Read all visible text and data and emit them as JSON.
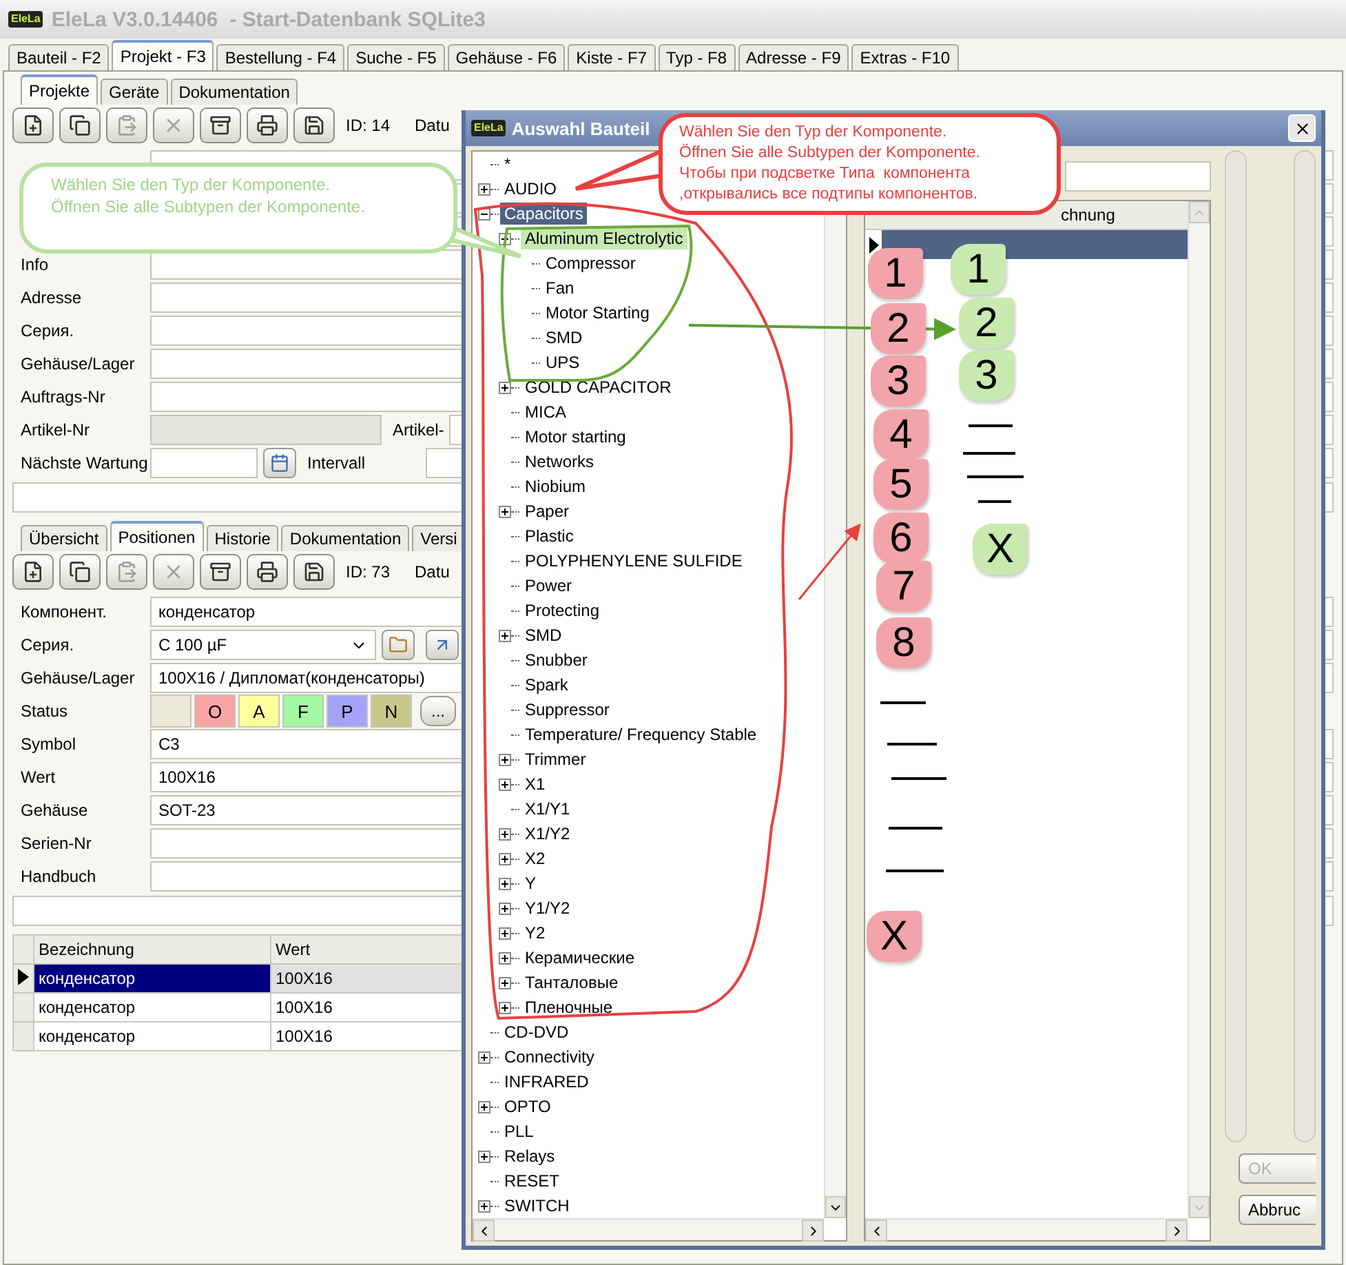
{
  "window": {
    "logo": "EleLa",
    "title": "EleLa V3.0.14406  - Start-Datenbank SQLite3"
  },
  "main_tabs": [
    {
      "label": "Bauteil - F2",
      "selected": false
    },
    {
      "label": "Projekt - F3",
      "selected": true
    },
    {
      "label": "Bestellung - F4",
      "selected": false
    },
    {
      "label": "Suche - F5",
      "selected": false
    },
    {
      "label": "Gehäuse - F6",
      "selected": false
    },
    {
      "label": "Kiste - F7",
      "selected": false
    },
    {
      "label": "Typ - F8",
      "selected": false
    },
    {
      "label": "Adresse - F9",
      "selected": false
    },
    {
      "label": "Extras - F10",
      "selected": false
    }
  ],
  "project_tabs": [
    {
      "label": "Projekte",
      "selected": true
    },
    {
      "label": "Geräte",
      "selected": false
    },
    {
      "label": "Dokumentation",
      "selected": false
    }
  ],
  "project_toolbar": {
    "buttons": [
      {
        "kind": "new",
        "disabled": false
      },
      {
        "kind": "copy",
        "disabled": false
      },
      {
        "kind": "paste",
        "disabled": true
      },
      {
        "kind": "delete",
        "disabled": true
      },
      {
        "kind": "archive",
        "disabled": false
      },
      {
        "kind": "print",
        "disabled": false
      },
      {
        "kind": "save",
        "disabled": false
      }
    ],
    "id": "ID: 14",
    "date_label": "Datu"
  },
  "project_form": {
    "fields": [
      {
        "label": "Info"
      },
      {
        "label": "Adresse"
      },
      {
        "label": "Серия."
      },
      {
        "label": "Gehäuse/Lager"
      },
      {
        "label": "Auftrags-Nr"
      }
    ],
    "article": {
      "label": "Artikel-Nr",
      "side_label": "Artikel-"
    },
    "maintenance": {
      "label": "Nächste Wartung",
      "interval_label": "Intervall"
    }
  },
  "position_tabs": [
    {
      "label": "Übersicht",
      "selected": false
    },
    {
      "label": "Positionen",
      "selected": true
    },
    {
      "label": "Historie",
      "selected": false
    },
    {
      "label": "Dokumentation",
      "selected": false
    },
    {
      "label": "Versi",
      "selected": false
    }
  ],
  "position_toolbar": {
    "buttons": [
      {
        "kind": "new",
        "disabled": false
      },
      {
        "kind": "copy",
        "disabled": false
      },
      {
        "kind": "paste",
        "disabled": true
      },
      {
        "kind": "delete",
        "disabled": true
      },
      {
        "kind": "archive",
        "disabled": false
      },
      {
        "kind": "print",
        "disabled": false
      },
      {
        "kind": "save",
        "disabled": false
      }
    ],
    "id": "ID: 73",
    "date_label": "Datu"
  },
  "position_form": {
    "component": {
      "label": "Компонент.",
      "value": "конденсатор"
    },
    "series": {
      "label": "Серия.",
      "value": "C 100 µF"
    },
    "housing_storage": {
      "label": "Gehäuse/Lager",
      "value": "100X16 / Дипломат(конденсаторы)"
    },
    "status": {
      "label": "Status",
      "buttons": [
        {
          "color": "#ece9d8"
        },
        {
          "text": "O",
          "color": "#f8a4a4"
        },
        {
          "text": "A",
          "color": "#ffff9c"
        },
        {
          "text": "F",
          "color": "#a4f8a4"
        },
        {
          "text": "P",
          "color": "#a4a4f8"
        },
        {
          "text": "N",
          "color": "#c8c88c"
        }
      ],
      "more": "..."
    },
    "fields": [
      {
        "label": "Symbol",
        "value": "C3"
      },
      {
        "label": "Wert",
        "value": "100X16"
      },
      {
        "label": "Gehäuse",
        "value": "SOT-23"
      },
      {
        "label": "Serien-Nr"
      },
      {
        "label": "Handbuch"
      }
    ]
  },
  "positions_table": {
    "columns": [
      "Bezeichnung",
      "Wert"
    ],
    "rows": [
      {
        "cells": [
          "конденсатор",
          "100X16"
        ],
        "selected": true
      },
      {
        "cells": [
          "конденсатор",
          "100X16"
        ],
        "selected": false
      },
      {
        "cells": [
          "конденсатор",
          "100X16"
        ],
        "selected": false
      }
    ]
  },
  "dialog": {
    "logo": "EleLa",
    "title": "Auswahl Bauteil",
    "tree": [
      {
        "label": "*",
        "kind": "leaf",
        "selected": false
      },
      {
        "label": "AUDIO",
        "kind": "group",
        "expanded": false,
        "selected": false
      },
      {
        "label": "Capacitors",
        "kind": "group",
        "expanded": true,
        "selected": true,
        "children": [
          {
            "label": "Aluminum Electrolytic",
            "kind": "group",
            "expanded": true,
            "selected": false,
            "highlighted": true,
            "children": [
              {
                "label": "Compressor",
                "kind": "leaf",
                "selected": false
              },
              {
                "label": "Fan",
                "kind": "leaf",
                "selected": false
              },
              {
                "label": "Motor Starting",
                "kind": "leaf",
                "selected": false
              },
              {
                "label": "SMD",
                "kind": "leaf",
                "selected": false
              },
              {
                "label": "UPS",
                "kind": "leaf",
                "selected": false
              }
            ]
          },
          {
            "label": "GOLD CAPACITOR",
            "kind": "group",
            "expanded": false,
            "selected": false
          },
          {
            "label": "MICA",
            "kind": "leaf",
            "selected": false
          },
          {
            "label": "Motor starting",
            "kind": "leaf",
            "selected": false
          },
          {
            "label": "Networks",
            "kind": "leaf",
            "selected": false
          },
          {
            "label": "Niobium",
            "kind": "leaf",
            "selected": false
          },
          {
            "label": "Paper",
            "kind": "group",
            "expanded": false,
            "selected": false
          },
          {
            "label": "Plastic",
            "kind": "leaf",
            "selected": false
          },
          {
            "label": "POLYPHENYLENE SULFIDE",
            "kind": "leaf",
            "selected": false
          },
          {
            "label": "Power",
            "kind": "leaf",
            "selected": false
          },
          {
            "label": "Protecting",
            "kind": "leaf",
            "selected": false
          },
          {
            "label": "SMD",
            "kind": "group",
            "expanded": false,
            "selected": false
          },
          {
            "label": "Snubber",
            "kind": "leaf",
            "selected": false
          },
          {
            "label": "Spark",
            "kind": "leaf",
            "selected": false
          },
          {
            "label": "Suppressor",
            "kind": "leaf",
            "selected": false
          },
          {
            "label": "Temperature/ Frequency Stable",
            "kind": "leaf",
            "selected": false
          },
          {
            "label": "Trimmer",
            "kind": "group",
            "expanded": false,
            "selected": false
          },
          {
            "label": "X1",
            "kind": "group",
            "expanded": false,
            "selected": false
          },
          {
            "label": "X1/Y1",
            "kind": "leaf",
            "selected": false
          },
          {
            "label": "X1/Y2",
            "kind": "group",
            "expanded": false,
            "selected": false
          },
          {
            "label": "X2",
            "kind": "group",
            "expanded": false,
            "selected": false
          },
          {
            "label": "Y",
            "kind": "group",
            "expanded": false,
            "selected": false
          },
          {
            "label": "Y1/Y2",
            "kind": "group",
            "expanded": false,
            "selected": false
          },
          {
            "label": "Y2",
            "kind": "group",
            "expanded": false,
            "selected": false
          },
          {
            "label": "Керамические",
            "kind": "group",
            "expanded": false,
            "selected": false
          },
          {
            "label": "Танталовые",
            "kind": "group",
            "expanded": false,
            "selected": false
          },
          {
            "label": "Пленочные",
            "kind": "group",
            "expanded": false,
            "selected": false
          }
        ]
      },
      {
        "label": "CD-DVD",
        "kind": "leaf",
        "selected": false
      },
      {
        "label": "Connectivity",
        "kind": "group",
        "expanded": false,
        "selected": false
      },
      {
        "label": "INFRARED",
        "kind": "leaf",
        "selected": false
      },
      {
        "label": "OPTO",
        "kind": "group",
        "expanded": false,
        "selected": false
      },
      {
        "label": "PLL",
        "kind": "leaf",
        "selected": false
      },
      {
        "label": "Relays",
        "kind": "group",
        "expanded": false,
        "selected": false
      },
      {
        "label": "RESET",
        "kind": "leaf",
        "selected": false
      },
      {
        "label": "SWITCH",
        "kind": "group",
        "expanded": false,
        "selected": false
      }
    ],
    "grid": {
      "column": "chnung",
      "rows": [
        {
          "selected": true
        }
      ]
    },
    "buttons": [
      {
        "label": "OK",
        "disabled": true
      },
      {
        "label": "Abbruc",
        "disabled": false
      }
    ]
  },
  "annotations": {
    "green_callout": [
      "Wählen Sie den Typ der Komponente.",
      "Öffnen Sie alle Subtypen der Komponente."
    ],
    "red_callout": [
      "Wählen Sie den Typ der Komponente.",
      "Öffnen Sie alle Subtypen der Komponente.",
      "Чтобы при подсветке Типа  компонента",
      ",открывались все подтипы компонентов."
    ],
    "pink_tags": [
      "1",
      "2",
      "3",
      "4",
      "5",
      "6",
      "7",
      "8",
      "X"
    ],
    "green_tags": [
      "1",
      "2",
      "3",
      "X"
    ]
  }
}
